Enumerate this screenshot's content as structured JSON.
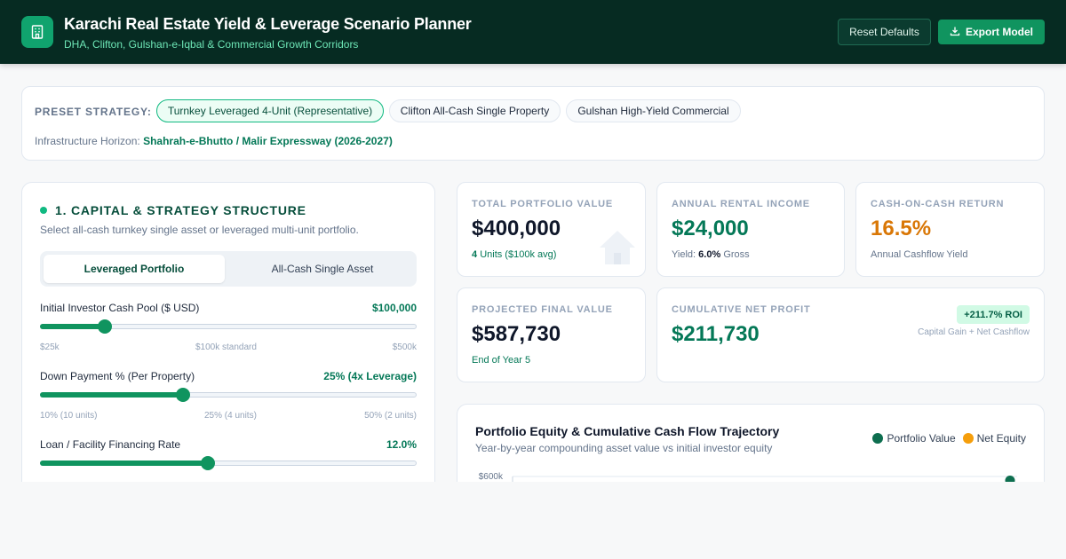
{
  "header": {
    "title": "Karachi Real Estate Yield & Leverage Scenario Planner",
    "subtitle": "DHA, Clifton, Gulshan-e-Iqbal & Commercial Growth Corridors",
    "reset_label": "Reset Defaults",
    "export_label": "Export Model",
    "logo_icon": "building-icon",
    "export_icon": "download-icon"
  },
  "presets": {
    "label": "PRESET STRATEGY:",
    "options": [
      "Turnkey Leveraged 4-Unit (Representative)",
      "Clifton All-Cash Single Property",
      "Gulshan High-Yield Commercial"
    ],
    "selected": "Turnkey Leveraged 4-Unit (Representative)",
    "horizon_label": "Infrastructure Horizon:",
    "horizon_value": "Shahrah-e-Bhutto / Malir Expressway (2026-2027)"
  },
  "capital": {
    "title": "1. CAPITAL & STRATEGY STRUCTURE",
    "subtitle": "Select all-cash turnkey single asset or leveraged multi-unit portfolio.",
    "modes": [
      "Leveraged Portfolio",
      "All-Cash Single Asset"
    ],
    "active_mode": "Leveraged Portfolio",
    "sliders": [
      {
        "label": "Initial Investor Cash Pool ($ USD)",
        "value_text": "$100,000",
        "level": 0.17,
        "ticks": [
          "$25k",
          "$100k standard",
          "$500k"
        ]
      },
      {
        "label": "Down Payment % (Per Property)",
        "value_text": "25% (4x Leverage)",
        "level": 0.38,
        "ticks": [
          "10% (10 units)",
          "25% (4 units)",
          "50% (2 units)"
        ]
      },
      {
        "label": "Loan / Facility Financing Rate",
        "value_text": "12.0%",
        "level": 0.445,
        "ticks": []
      }
    ]
  },
  "stats": {
    "total_value": {
      "label": "TOTAL PORTFOLIO VALUE",
      "value": "$400,000",
      "units_count": "4",
      "units_text": "Units ($100k avg)",
      "icon": "house-icon"
    },
    "rental_income": {
      "label": "ANNUAL RENTAL INCOME",
      "value": "$24,000",
      "yield_prefix": "Yield:",
      "yield_value": "6.0%",
      "yield_suffix": "Gross"
    },
    "coc_return": {
      "label": "CASH-ON-CASH RETURN",
      "value": "16.5%",
      "foot": "Annual Cashflow Yield"
    },
    "final_value": {
      "label": "PROJECTED FINAL VALUE",
      "value": "$587,730",
      "foot": "End of Year 5"
    },
    "net_profit": {
      "label": "CUMULATIVE NET PROFIT",
      "value": "$211,730",
      "roi": "+211.7% ROI",
      "note": "Capital Gain + Net Cashflow"
    }
  },
  "colors": {
    "primary": "#10945f",
    "dark": "#062b22",
    "accent_orange": "#d97706",
    "equity": "#f59e0b"
  },
  "chart": {
    "title": "Portfolio Equity & Cumulative Cash Flow Trajectory",
    "subtitle": "Year-by-year compounding asset value vs initial investor equity",
    "legend": [
      "Portfolio Value",
      "Net Equity"
    ],
    "y_top_label": "$600k"
  },
  "chart_data": {
    "type": "line",
    "title": "Portfolio Equity & Cumulative Cash Flow Trajectory",
    "ylim": [
      0,
      600000
    ],
    "series": [
      {
        "name": "Portfolio Value",
        "color": "#0d6e4f",
        "values": [
          587730
        ]
      },
      {
        "name": "Net Equity",
        "color": "#f59e0b",
        "values": []
      }
    ]
  }
}
